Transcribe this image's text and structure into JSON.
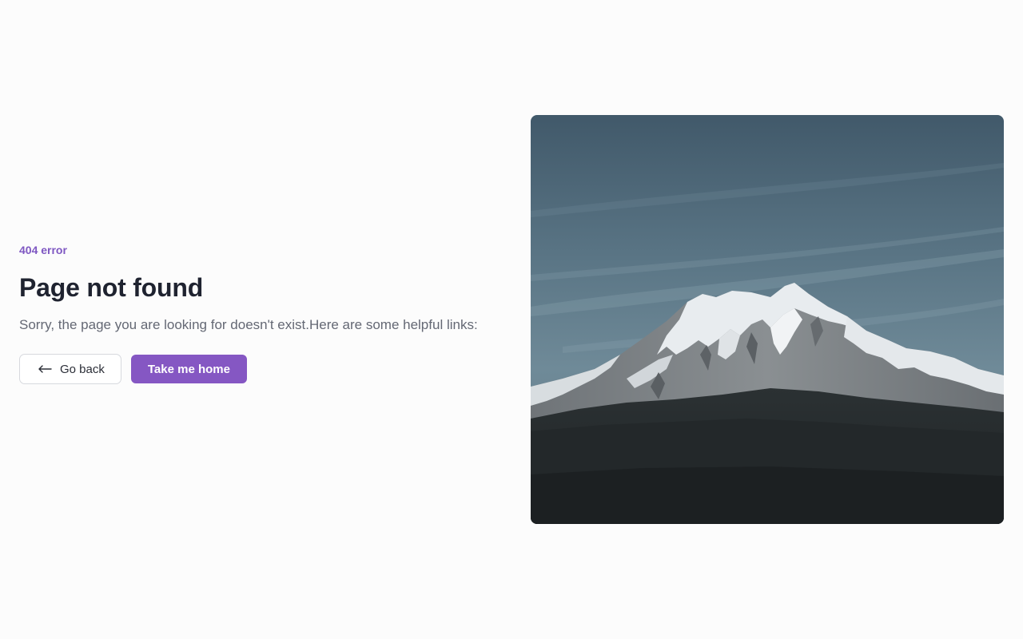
{
  "error": {
    "code_label": "404 error",
    "title": "Page not found",
    "description": "Sorry, the page you are looking for doesn't exist.Here are some helpful links:"
  },
  "actions": {
    "back_label": "Go back",
    "back_icon": "arrow-left-icon",
    "home_label": "Take me home"
  },
  "illustration": {
    "subject": "snow-capped-mountain-photo"
  },
  "colors": {
    "accent": "#8557c3",
    "eyebrow": "#7e57c2",
    "heading": "#1f2330",
    "body_text": "#646874",
    "background": "#fcfcfc"
  }
}
